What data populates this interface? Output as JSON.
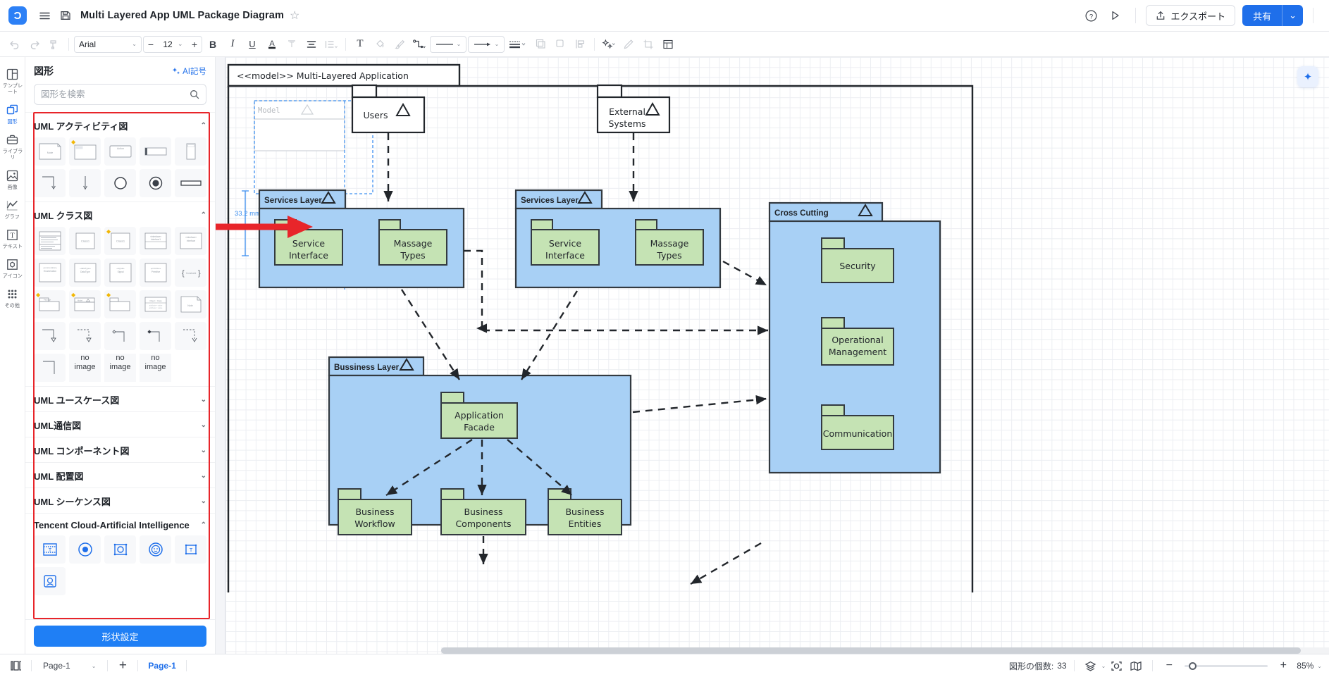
{
  "app": {
    "logo_glyph": "Ɔ",
    "menu_icon": "menu-icon",
    "save_icon": "save-icon",
    "doc_title": "Multi Layered App UML Package Diagram",
    "star_glyph": "☆",
    "help_label": "?",
    "present_label": "▷",
    "export_label": "エクスポート",
    "share_label": "共有",
    "share_caret": "⌄"
  },
  "toolbar": {
    "undo": "↶",
    "redo": "↷",
    "format_painter": "paint-format-icon",
    "font_name": "Arial",
    "font_caret": "⌄",
    "size_minus": "−",
    "font_size": "12",
    "size_caret": "⌄",
    "size_plus": "+",
    "bold": "B",
    "italic": "I",
    "underline": "U",
    "font_color": "A",
    "strike": "T",
    "align": "≡",
    "line_spacing": "≡",
    "text_box": "T",
    "fill": "fill-bucket-icon",
    "brush": "brush-icon",
    "connector": "connector-icon",
    "line_style": "line-style",
    "arrow_style": "arrow-style",
    "line_weight": "line-weight",
    "bring_front": "bring-to-front",
    "send_back": "send-to-back",
    "align_objects": "align-objects",
    "effects": "effects-icon",
    "edit": "edit-icon",
    "crop": "crop-icon",
    "table": "table-icon"
  },
  "rail": {
    "items": [
      {
        "label": "テンプレート",
        "icon": "template-icon",
        "active": false
      },
      {
        "label": "図形",
        "icon": "shapes-icon",
        "active": true
      },
      {
        "label": "ライブラリ",
        "icon": "library-icon",
        "active": false
      },
      {
        "label": "画像",
        "icon": "image-icon",
        "active": false
      },
      {
        "label": "グラフ",
        "icon": "chart-icon",
        "active": false
      },
      {
        "label": "テキスト",
        "icon": "text-icon",
        "active": false
      },
      {
        "label": "アイコン",
        "icon": "icon-icon",
        "active": false
      },
      {
        "label": "その他",
        "icon": "more-icon",
        "active": false
      }
    ]
  },
  "panel": {
    "title": "図形",
    "ai_label": "AI記号",
    "search_placeholder": "図形を検索",
    "search_value": "",
    "sections": [
      {
        "name": "UML アクティビティ図",
        "expanded": true,
        "caret": "⌃"
      },
      {
        "name": "UML クラス図",
        "expanded": true,
        "caret": "⌃"
      },
      {
        "name": "UML ユースケース図",
        "expanded": false,
        "caret": "⌄"
      },
      {
        "name": "UML通信図",
        "expanded": false,
        "caret": "⌄"
      },
      {
        "name": "UML コンポーネント図",
        "expanded": false,
        "caret": "⌄"
      },
      {
        "name": "UML 配置図",
        "expanded": false,
        "caret": "⌄"
      },
      {
        "name": "UML シーケンス図",
        "expanded": false,
        "caret": "⌄"
      },
      {
        "name": "Tencent Cloud-Artificial Intelligence",
        "expanded": true,
        "caret": "⌃"
      }
    ],
    "no_image_label": "no image",
    "shape_settings_button": "形状設定"
  },
  "canvas": {
    "measure_label": "33.2 mm",
    "model_placeholder": "Model",
    "ai_sparkle": "✦",
    "diagram": {
      "frame_title": "<<model>> Multi-Layered Application",
      "packages": [
        {
          "name": "Users",
          "kind": "tab-package"
        },
        {
          "name": "External\nSystems",
          "kind": "tab-package"
        },
        {
          "name": "Services Layer",
          "kind": "layer"
        },
        {
          "name": "Services Layer",
          "kind": "layer"
        },
        {
          "name": "Cross Cutting",
          "kind": "layer"
        },
        {
          "name": "Bussiness Layer",
          "kind": "layer"
        },
        {
          "name": "Service\nInterface",
          "kind": "green"
        },
        {
          "name": "Massage\nTypes",
          "kind": "green"
        },
        {
          "name": "Service\nInterface",
          "kind": "green"
        },
        {
          "name": "Massage\nTypes",
          "kind": "green"
        },
        {
          "name": "Security",
          "kind": "green"
        },
        {
          "name": "Operational\nManagement",
          "kind": "green"
        },
        {
          "name": "Communication",
          "kind": "green"
        },
        {
          "name": "Application\nFacade",
          "kind": "green"
        },
        {
          "name": "Business\nWorkflow",
          "kind": "green"
        },
        {
          "name": "Business\nComponents",
          "kind": "green"
        },
        {
          "name": "Business\nEntities",
          "kind": "green"
        }
      ],
      "labels": {
        "frame": "<<model>> Multi-Layered Application",
        "users": "Users",
        "external_1": "External",
        "external_2": "Systems",
        "services_layer_left": "Services Layer",
        "services_layer_right": "Services Layer",
        "cross_cutting": "Cross Cutting",
        "business_layer": "Bussiness Layer",
        "service_interface_a1": "Service",
        "service_interface_a2": "Interface",
        "massage_types_a1": "Massage",
        "massage_types_a2": "Types",
        "service_interface_b1": "Service",
        "service_interface_b2": "Interface",
        "massage_types_b1": "Massage",
        "massage_types_b2": "Types",
        "security": "Security",
        "operational_1": "Operational",
        "operational_2": "Management",
        "communication": "Communication",
        "app_facade_1": "Application",
        "app_facade_2": "Facade",
        "biz_workflow_1": "Business",
        "biz_workflow_2": "Workflow",
        "biz_components_1": "Business",
        "biz_components_2": "Components",
        "biz_entities_1": "Business",
        "biz_entities_2": "Entities"
      },
      "colors": {
        "layer_fill": "#a8d0f5",
        "green_fill": "#c5e3b4",
        "stroke": "#333a40",
        "selection": "#3e90f0",
        "annotation_arrow": "#e8252a"
      }
    }
  },
  "statusbar": {
    "page_picker_icon": "page-layout-icon",
    "page_picker_value": "Page-1",
    "page_picker_caret": "⌄",
    "add_page": "+",
    "page_tab": "Page-1",
    "shape_count_label": "図形の個数:",
    "shape_count_value": "33",
    "layers_icon": "layers-icon",
    "layers_caret": "⌄",
    "focus_icon": "focus-icon",
    "minimap_icon": "minimap-icon",
    "zoom_out": "−",
    "zoom_in": "+",
    "zoom_value": "85%",
    "zoom_caret": "⌄"
  }
}
